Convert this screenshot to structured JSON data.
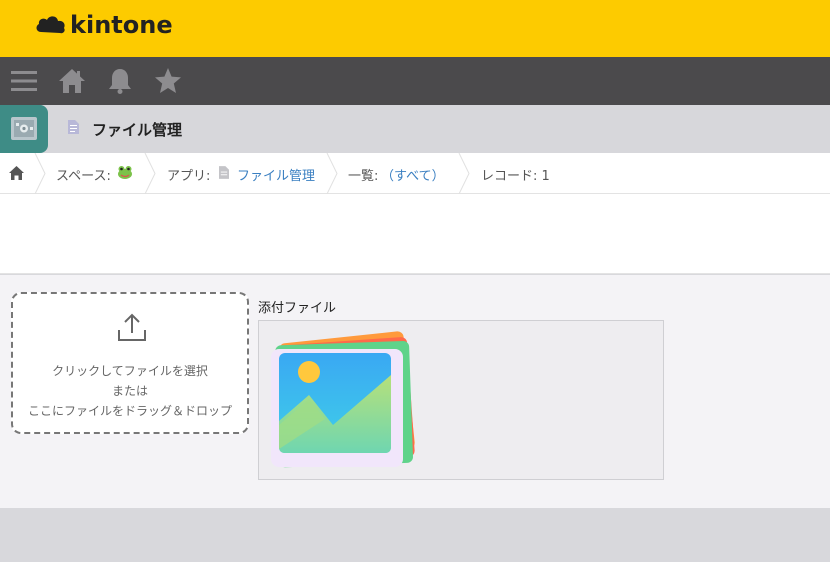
{
  "brand": {
    "name": "kintone"
  },
  "nav": {
    "items": [
      {
        "name": "menu-icon"
      },
      {
        "name": "home-icon"
      },
      {
        "name": "bell-icon"
      },
      {
        "name": "star-icon"
      }
    ]
  },
  "app": {
    "title": "ファイル管理"
  },
  "breadcrumb": {
    "space_label": "スペース:",
    "app_label": "アプリ:",
    "app_name": "ファイル管理",
    "list_label": "一覧:",
    "list_view": "（すべて）",
    "record_label": "レコード: 1"
  },
  "upload": {
    "line1": "クリックしてファイルを選択",
    "line2": "または",
    "line3": "ここにファイルをドラッグ＆ドロップ"
  },
  "attachment": {
    "label": "添付ファイル"
  },
  "colors": {
    "brand_yellow": "#fdcb00",
    "nav_dark": "#4b4a4c",
    "link_blue": "#3a7fc1",
    "app_teal": "#3e8c86"
  }
}
